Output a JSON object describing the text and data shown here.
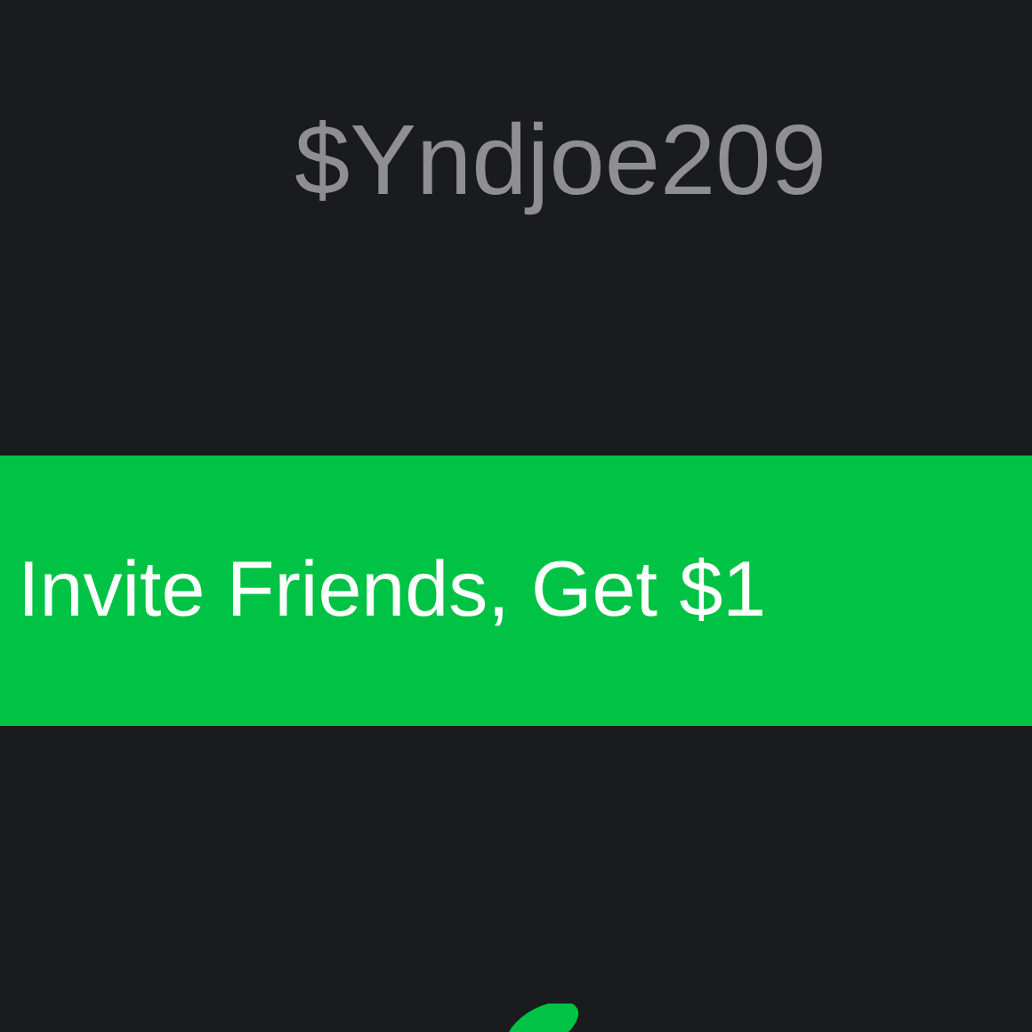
{
  "profile": {
    "cashtag": "$Yndjoe209"
  },
  "invite_banner": {
    "label": "Invite Friends, Get $1"
  }
}
